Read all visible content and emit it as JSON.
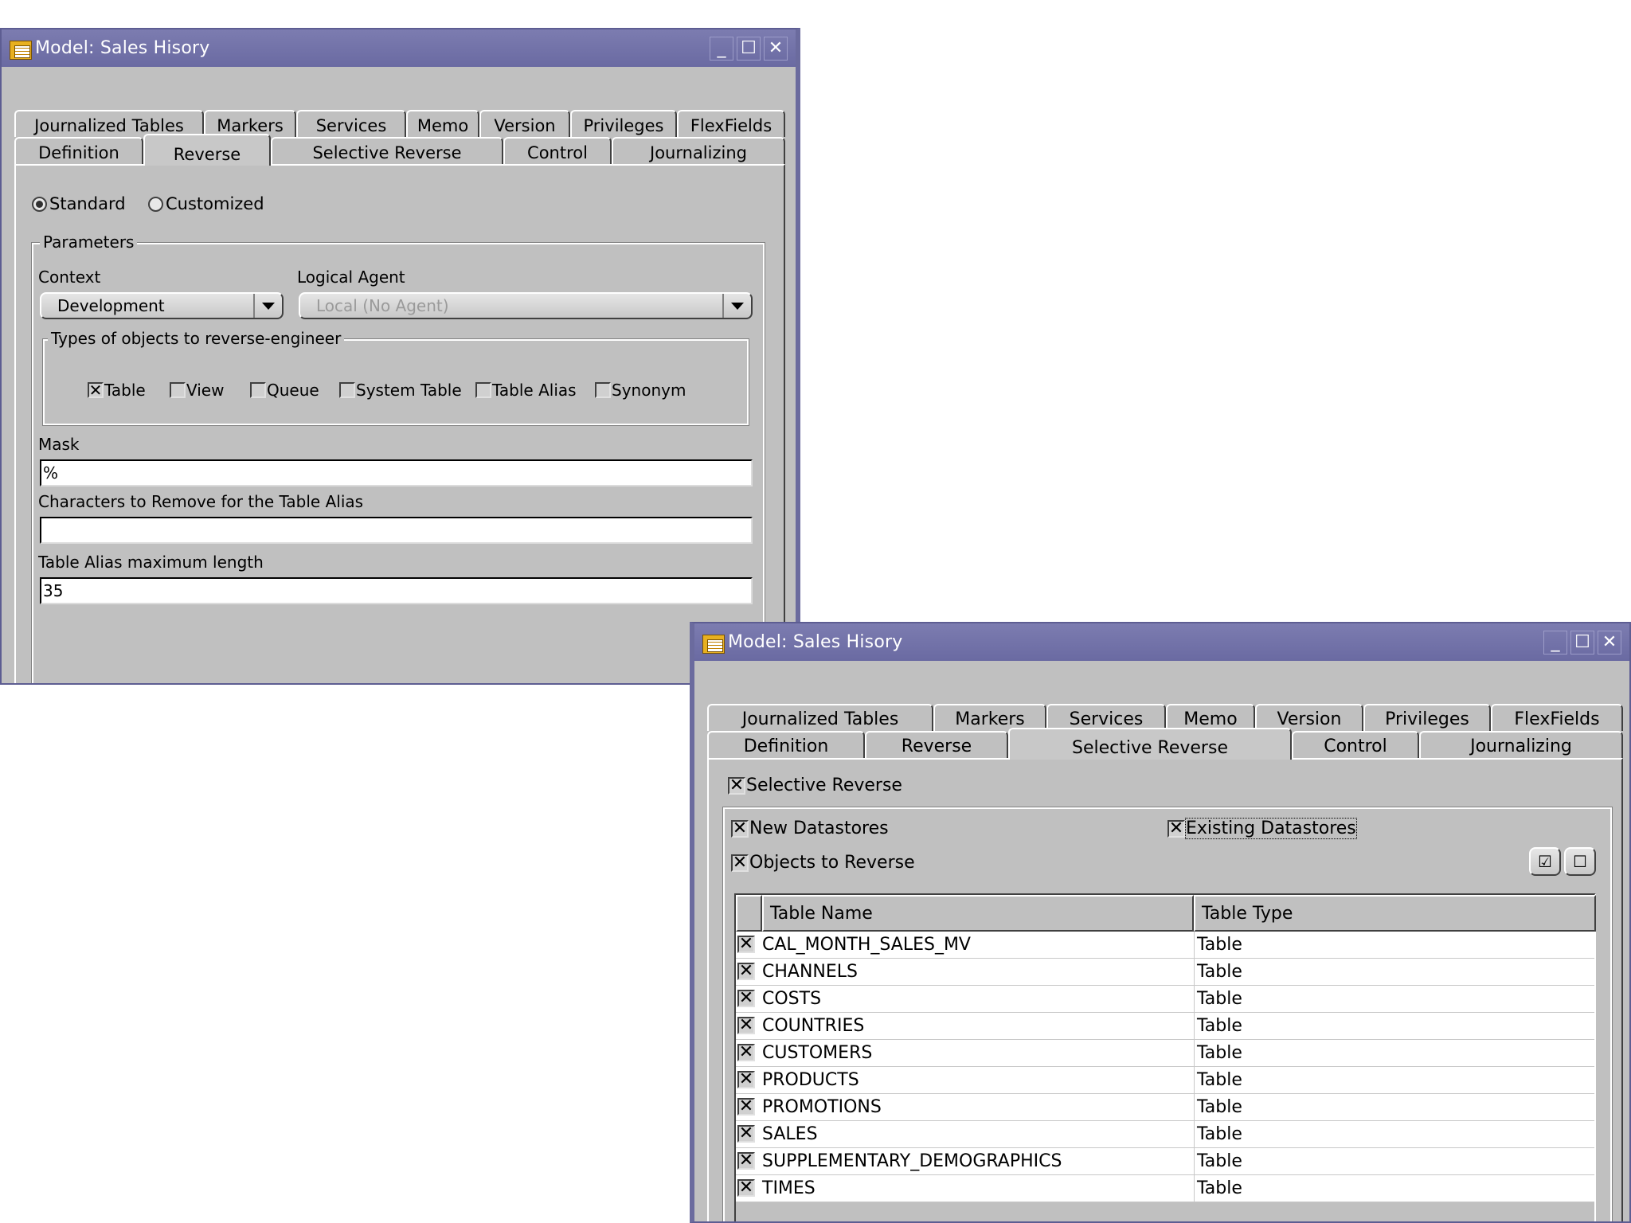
{
  "window1": {
    "title": "Model: Sales Hisory",
    "tabs_row1": [
      "Journalized Tables",
      "Markers",
      "Services",
      "Memo",
      "Version",
      "Privileges",
      "FlexFields"
    ],
    "tabs_row2": [
      "Definition",
      "Reverse",
      "Selective Reverse",
      "Control",
      "Journalizing"
    ],
    "active_tab": "Reverse",
    "radio_standard": "Standard",
    "radio_customized": "Customized",
    "selected_radio": "Standard",
    "parameters_label": "Parameters",
    "context_label": "Context",
    "context_value": "Development",
    "logical_agent_label": "Logical Agent",
    "logical_agent_value": "Local (No Agent)",
    "types_label": "Types of objects to reverse-engineer",
    "types": [
      {
        "label": "Table",
        "checked": true
      },
      {
        "label": "View",
        "checked": false
      },
      {
        "label": "Queue",
        "checked": false
      },
      {
        "label": "System Table",
        "checked": false
      },
      {
        "label": "Table Alias",
        "checked": false
      },
      {
        "label": "Synonym",
        "checked": false
      }
    ],
    "mask_label": "Mask",
    "mask_value": "%",
    "chars_remove_label": "Characters to Remove for the Table Alias",
    "chars_remove_value": "",
    "alias_max_label": "Table Alias maximum length",
    "alias_max_value": "35"
  },
  "window2": {
    "title": "Model: Sales Hisory",
    "tabs_row1": [
      "Journalized Tables",
      "Markers",
      "Services",
      "Memo",
      "Version",
      "Privileges",
      "FlexFields"
    ],
    "tabs_row2": [
      "Definition",
      "Reverse",
      "Selective Reverse",
      "Control",
      "Journalizing"
    ],
    "active_tab": "Selective Reverse",
    "selective_reverse_label": "Selective Reverse",
    "new_datastores_label": "New Datastores",
    "existing_datastores_label": "Existing Datastores",
    "objects_to_reverse_label": "Objects to Reverse",
    "columns": [
      "Table Name",
      "Table Type"
    ],
    "rows": [
      {
        "name": "CAL_MONTH_SALES_MV",
        "type": "Table"
      },
      {
        "name": "CHANNELS",
        "type": "Table"
      },
      {
        "name": "COSTS",
        "type": "Table"
      },
      {
        "name": "COUNTRIES",
        "type": "Table"
      },
      {
        "name": "CUSTOMERS",
        "type": "Table"
      },
      {
        "name": "PRODUCTS",
        "type": "Table"
      },
      {
        "name": "PROMOTIONS",
        "type": "Table"
      },
      {
        "name": "SALES",
        "type": "Table"
      },
      {
        "name": "SUPPLEMENTARY_DEMOGRAPHICS",
        "type": "Table"
      },
      {
        "name": "TIMES",
        "type": "Table"
      }
    ]
  },
  "colors": {
    "titlebar": "#6a6aa2",
    "window_bg": "#c0c0c0"
  }
}
